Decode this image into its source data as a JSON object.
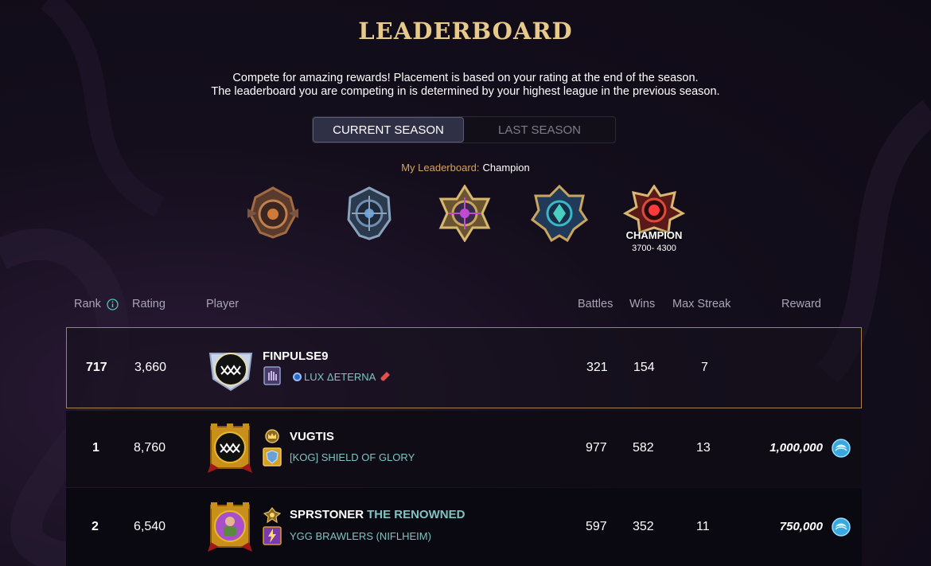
{
  "header": {
    "title": "LEADERBOARD",
    "subtitle_line1": "Compete for amazing rewards! Placement is based on your rating at the end of the season.",
    "subtitle_line2": "The leaderboard you are competing in is determined by your highest league in the previous season."
  },
  "tabs": {
    "current": "CURRENT SEASON",
    "last": "LAST SEASON",
    "active": "current"
  },
  "my_leaderboard": {
    "label": "My Leaderboard:",
    "value": "Champion"
  },
  "leagues": [
    {
      "icon": "bronze-league-icon"
    },
    {
      "icon": "silver-league-icon"
    },
    {
      "icon": "gold-league-icon"
    },
    {
      "icon": "diamond-league-icon"
    },
    {
      "icon": "champion-league-icon",
      "name": "CHAMPION",
      "range": "3700- 4300"
    }
  ],
  "table": {
    "headers": {
      "rank": "Rank",
      "rating": "Rating",
      "player": "Player",
      "battles": "Battles",
      "wins": "Wins",
      "max_streak": "Max Streak",
      "reward": "Reward"
    },
    "my_row": {
      "rank": "717",
      "rating": "3,660",
      "player": "FINPULSE9",
      "title": "",
      "guild": "LUX ΔETERNA",
      "battles": "321",
      "wins": "154",
      "max_streak": "7",
      "reward": ""
    },
    "rows": [
      {
        "rank": "1",
        "rating": "8,760",
        "player": "VUGTIS",
        "title": "",
        "guild": "[KOG] SHIELD OF GLORY",
        "battles": "977",
        "wins": "582",
        "max_streak": "13",
        "reward": "1,000,000"
      },
      {
        "rank": "2",
        "rating": "6,540",
        "player": "SPRSTONER",
        "title": "THE RENOWNED",
        "guild": "YGG BRAWLERS (NIFLHEIM)",
        "battles": "597",
        "wins": "352",
        "max_streak": "11",
        "reward": "750,000"
      }
    ]
  },
  "colors": {
    "title_gold": "#e7c98a",
    "guild_teal": "#7fc4c2",
    "highlight_border": "#a6834d",
    "label_orange": "#d4a25c"
  }
}
